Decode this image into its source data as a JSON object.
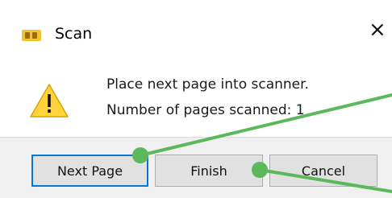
{
  "window": {
    "title": "Scan",
    "close_glyph": "×"
  },
  "message": {
    "line1": "Place next page into scanner.",
    "line2": "Number of pages scanned: 1"
  },
  "buttons": {
    "next_page": "Next Page",
    "finish": "Finish",
    "cancel": "Cancel"
  },
  "colors": {
    "warning_fill": "#ffd43b",
    "annotation_green": "#5cb85c",
    "focus_border": "#0078d7"
  },
  "icons": {
    "app": "scanner-app-icon",
    "warning": "warning-icon",
    "close": "close-icon"
  }
}
